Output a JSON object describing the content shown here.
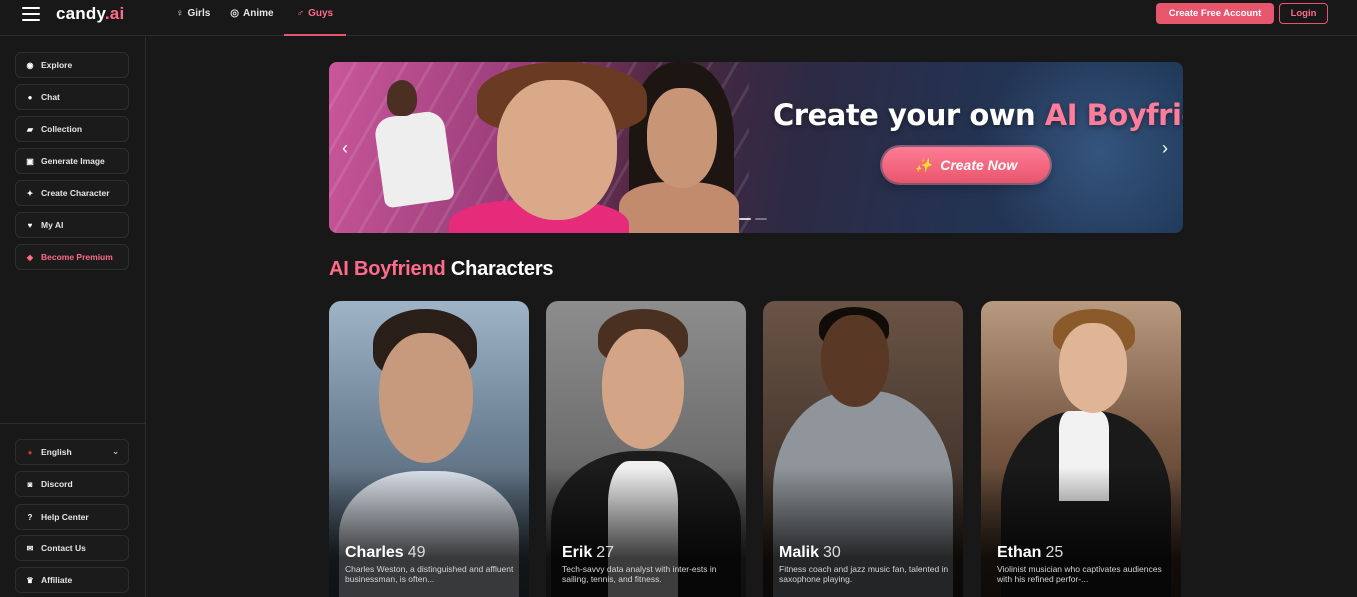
{
  "header": {
    "logo": {
      "name": "candy",
      "dot": ".ai"
    },
    "nav": [
      {
        "label": "Girls",
        "icon": "♀",
        "active": false
      },
      {
        "label": "Anime",
        "icon": "◎",
        "active": false
      },
      {
        "label": "Guys",
        "icon": "♂",
        "active": true
      }
    ],
    "create_account_label": "Create Free Account",
    "login_label": "Login"
  },
  "sidebar": {
    "items": [
      {
        "label": "Explore",
        "icon": "compass-icon",
        "glyph": "◉"
      },
      {
        "label": "Chat",
        "icon": "chat-icon",
        "glyph": "●"
      },
      {
        "label": "Collection",
        "icon": "collection-icon",
        "glyph": "▰"
      },
      {
        "label": "Generate Image",
        "icon": "image-icon",
        "glyph": "▣"
      },
      {
        "label": "Create Character",
        "icon": "wand-icon",
        "glyph": "✦"
      },
      {
        "label": "My AI",
        "icon": "heart-icon",
        "glyph": "♥"
      },
      {
        "label": "Become Premium",
        "icon": "diamond-icon",
        "glyph": "◆"
      }
    ],
    "footer": [
      {
        "label": "English",
        "icon": "flag-icon",
        "glyph": "●"
      },
      {
        "label": "Discord",
        "icon": "discord-icon",
        "glyph": "◙"
      },
      {
        "label": "Help Center",
        "icon": "help-icon",
        "glyph": "?"
      },
      {
        "label": "Contact Us",
        "icon": "contact-icon",
        "glyph": "✉"
      },
      {
        "label": "Affiliate",
        "icon": "trophy-icon",
        "glyph": "♛"
      }
    ]
  },
  "banner": {
    "title_main": "Create your own ",
    "title_accent": "AI Boyfriend",
    "cta_label": "Create Now",
    "prev": "‹",
    "next": "›"
  },
  "section": {
    "title_accent": "AI Boyfriend",
    "title_rest": " Characters"
  },
  "cards": [
    {
      "name": "Charles",
      "age": "49",
      "description": "Charles Weston, a distinguished and affluent businessman, is often..."
    },
    {
      "name": "Erik",
      "age": "27",
      "description": "Tech-savvy data analyst with inter-ests in sailing, tennis, and fitness."
    },
    {
      "name": "Malik",
      "age": "30",
      "description": "Fitness coach and jazz music fan, talented in saxophone playing."
    },
    {
      "name": "Ethan",
      "age": "25",
      "description": "Violinist musician who captivates audiences with his refined perfor-..."
    }
  ],
  "colors": {
    "accent": "#e8566d",
    "accent_text": "#ff6b8a",
    "background": "#181818"
  }
}
